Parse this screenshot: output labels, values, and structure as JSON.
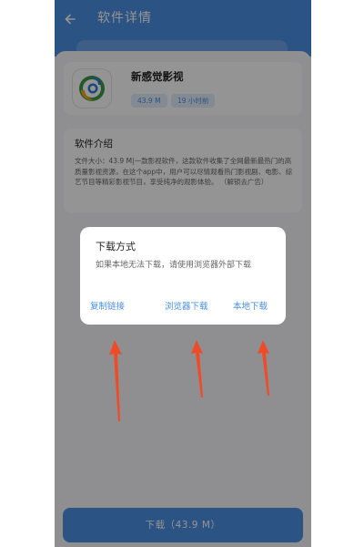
{
  "header": {
    "title": "软件详情"
  },
  "app": {
    "name": "新感觉影视",
    "size_tag": "43.9 M",
    "time_tag": "19 小时前"
  },
  "intro": {
    "title": "软件介绍",
    "text": "文件大小：43.9 M|一款影视软件，这款软件收集了全网最新最热门的高质量影视资源，在这个app中，用户可以尽情观看热门影视剧、电影、综艺节目等精彩影视节目，享受纯净的观影体验。 （解锁去广告）"
  },
  "download_button": {
    "label": "下载（43.9 M）"
  },
  "dialog": {
    "title": "下载方式",
    "message": "如果本地无法下载，请使用浏览器外部下载",
    "buttons": {
      "copy": "复制链接",
      "browser": "浏览器下载",
      "local": "本地下载"
    }
  },
  "colors": {
    "primary": "#4a8fe2",
    "annotation_arrow": "#f04a26"
  },
  "icons": [
    "back-arrow-icon",
    "app-logo-icon"
  ]
}
